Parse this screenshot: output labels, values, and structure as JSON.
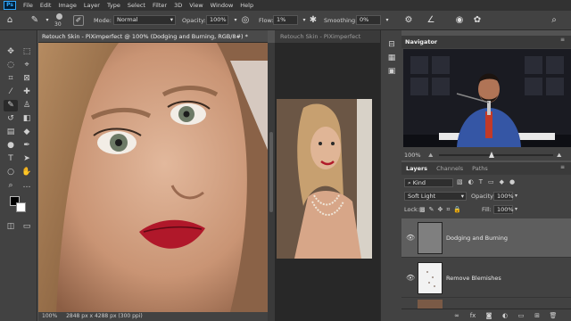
{
  "menubar": {
    "logo": "Ps",
    "items": [
      "File",
      "Edit",
      "Image",
      "Layer",
      "Type",
      "Select",
      "Filter",
      "3D",
      "View",
      "Window",
      "Help"
    ]
  },
  "options": {
    "brush_size": "30",
    "mode_label": "Mode:",
    "mode_value": "Normal",
    "opacity_label": "Opacity:",
    "opacity_value": "100%",
    "flow_label": "Flow:",
    "flow_value": "1%",
    "smoothing_label": "Smoothing:",
    "smoothing_value": "0%"
  },
  "document1": {
    "tab_title": "Retouch Skin - PiXimperfect @ 100% (Dodging and Burning, RGB/8#) *",
    "zoom": "100%",
    "doc_info": "2848 px x 4288 px (300 ppi)"
  },
  "document2": {
    "tab_title": "Retouch Skin - PiXimperfect"
  },
  "navigator": {
    "title": "Navigator",
    "zoom": "100%"
  },
  "layers_panel": {
    "tabs": [
      "Layers",
      "Channels",
      "Paths"
    ],
    "filter_label": "Kind",
    "blend_mode": "Soft Light",
    "opacity_label": "Opacity:",
    "opacity_value": "100%",
    "lock_label": "Lock:",
    "fill_label": "Fill:",
    "fill_value": "100%",
    "layers": [
      {
        "name": "Dodging and Burning",
        "selected": true
      },
      {
        "name": "Remove Blemishes",
        "selected": false
      }
    ]
  },
  "colors": {
    "accent": "#31a8ff",
    "panel_bg": "#424242",
    "menubar_bg": "#323232"
  }
}
